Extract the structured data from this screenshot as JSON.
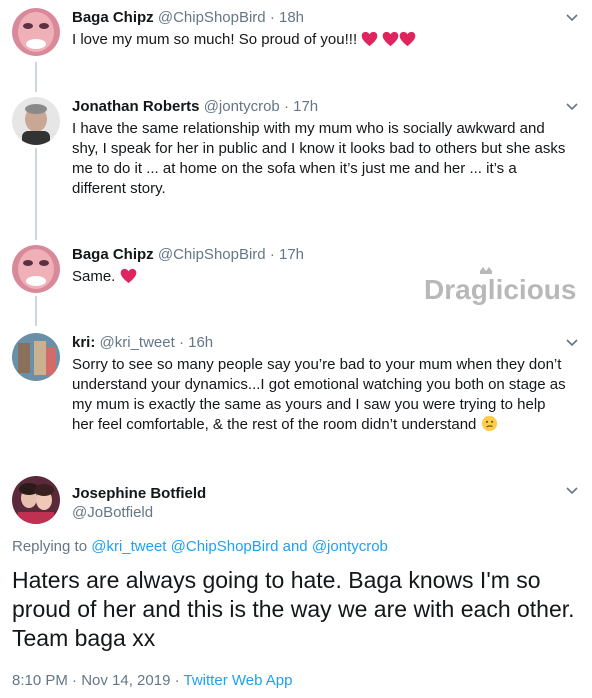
{
  "tweets": [
    {
      "name": "Baga Chipz",
      "handle": "@ChipShopBird",
      "time": "18h",
      "text": "I love my mum so much! So proud of you!!!"
    },
    {
      "name": "Jonathan Roberts",
      "handle": "@jontycrob",
      "time": "17h",
      "text": "I have the same relationship with my mum who is socially awkward and shy, I speak for her in public and I know it looks bad to others but she asks me to do it ... at home on the sofa when it’s just me and her ... it’s a different story."
    },
    {
      "name": "Baga Chipz",
      "handle": "@ChipShopBird",
      "time": "17h",
      "text": "Same."
    },
    {
      "name": "kri:",
      "handle": "@kri_tweet",
      "time": "16h",
      "text": "Sorry to see so many people say you’re bad to your mum when they don’t understand your dynamics...I got emotional watching you both on stage as my mum is exactly the same as yours and I saw you were trying to help her feel comfortable, & the rest of the room didn’t understand"
    }
  ],
  "separator": "·",
  "watermark": {
    "text": "Draglicious"
  },
  "focal": {
    "name": "Josephine Botfield",
    "handle": "@JoBotfield",
    "replying_prefix": "Replying to",
    "replying_to": [
      "@kri_tweet",
      "@ChipShopBird",
      "@jontycrob"
    ],
    "replying_and": "and",
    "text": "Haters are always going to hate. Baga knows I'm so proud of her and this is the way we are with each other. Team baga xx",
    "timestamp": "8:10 PM · Nov 14, 2019",
    "app": "Twitter Web App"
  },
  "colors": {
    "link": "#1da1f2",
    "secondary": "#657786",
    "heart": "#e0245e",
    "thread_line": "#ccd6dd"
  },
  "icons": [
    "chevron-down-icon",
    "heart-emoji",
    "confused-face-emoji"
  ]
}
